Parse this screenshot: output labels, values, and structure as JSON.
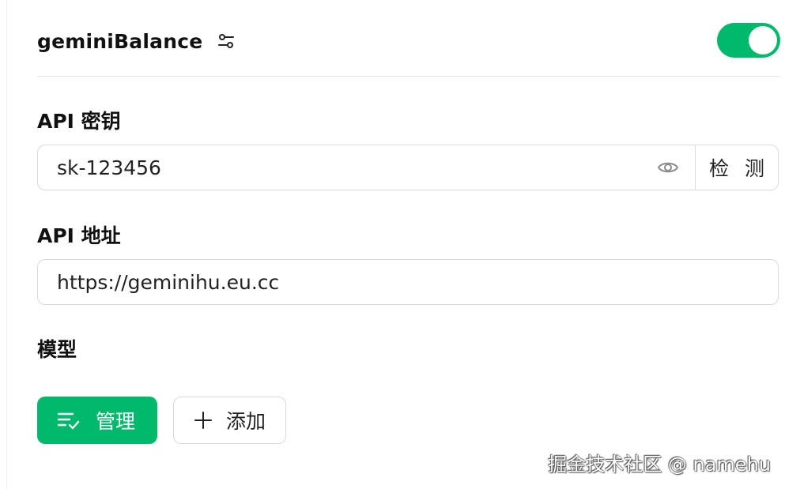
{
  "provider": {
    "name": "geminiBalance",
    "enabled": true,
    "toggle_color": "#00b96b",
    "settings_icon": "sliders-icon"
  },
  "api_key": {
    "label": "API 密钥",
    "value": "sk-123456",
    "visibility_icon": "eye-icon",
    "check_button_label": "检 测"
  },
  "api_url": {
    "label": "API 地址",
    "value": "https://geminihu.eu.cc"
  },
  "models": {
    "label": "模型",
    "manage_button_label": "管理",
    "manage_icon": "list-check-icon",
    "add_button_label": "添加",
    "add_icon": "plus-icon",
    "accent_color": "#00b96b"
  },
  "watermark": {
    "text": "掘金技术社区 @ namehu"
  }
}
